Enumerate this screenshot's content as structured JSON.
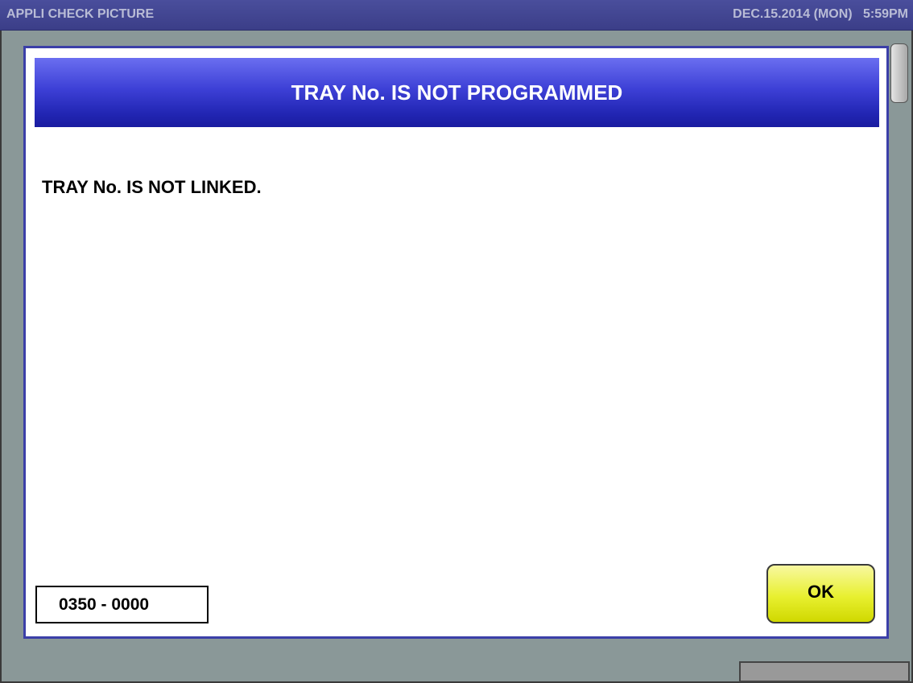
{
  "header": {
    "app_title": "APPLI CHECK PICTURE",
    "datetime": "DEC.15.2014 (MON)   5:59PM"
  },
  "dialog": {
    "title": "TRAY No. IS NOT PROGRAMMED",
    "message": "TRAY No. IS NOT LINKED.",
    "code": "0350 - 0000",
    "ok_label": "OK"
  },
  "colors": {
    "title_bar": "#4a4e9c",
    "dialog_header": "#3d40d6",
    "ok_button": "#e8f030",
    "background": "#8a9898"
  }
}
